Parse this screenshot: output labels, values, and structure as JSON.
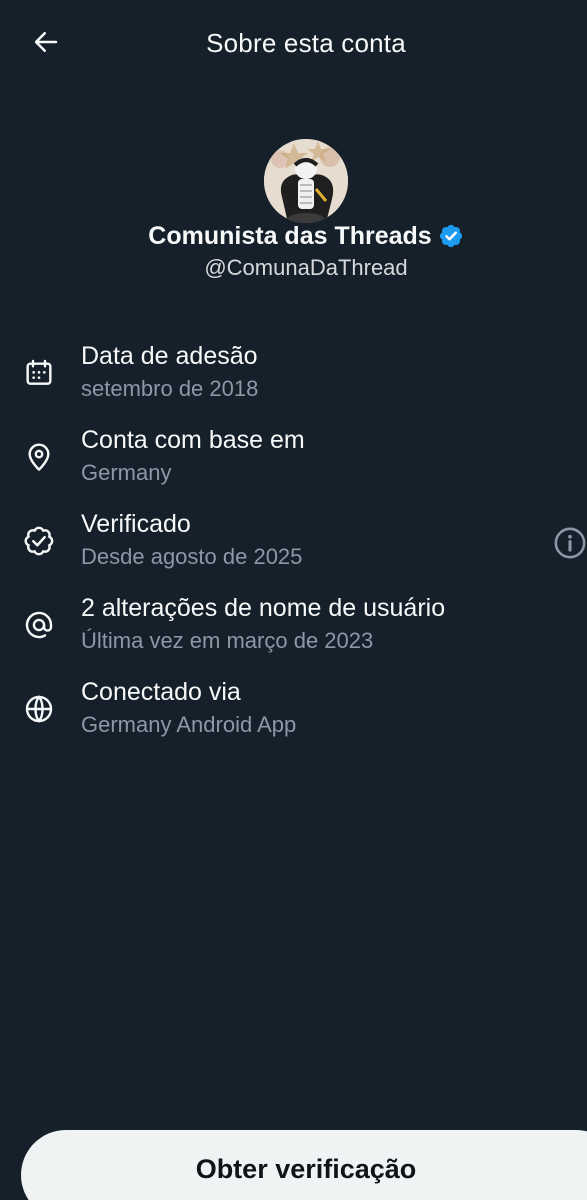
{
  "header": {
    "title": "Sobre esta conta",
    "back_icon": "arrow-left-icon"
  },
  "profile": {
    "display_name": "Comunista das Threads",
    "handle": "@ComunaDaThread",
    "verified": true,
    "verified_color": "#1d9bf0"
  },
  "info": [
    {
      "icon": "calendar-icon",
      "title": "Data de adesão",
      "subtitle": "setembro de 2018"
    },
    {
      "icon": "location-pin-icon",
      "title": "Conta com base em",
      "subtitle": "Germany"
    },
    {
      "icon": "verified-check-icon",
      "title": "Verificado",
      "subtitle": "Desde agosto de 2025",
      "action_icon": "info-icon"
    },
    {
      "icon": "at-sign-icon",
      "title": "2 alterações de nome de usuário",
      "subtitle": "Última vez em março de 2023"
    },
    {
      "icon": "globe-icon",
      "title": "Conectado via",
      "subtitle": "Germany Android App"
    }
  ],
  "cta": {
    "label": "Obter verificação"
  },
  "colors": {
    "background": "#15202b",
    "primary_text": "#f7f9f9",
    "secondary_text": "#8b98a5",
    "button_bg": "#eff3f4",
    "button_text": "#0f1419"
  }
}
